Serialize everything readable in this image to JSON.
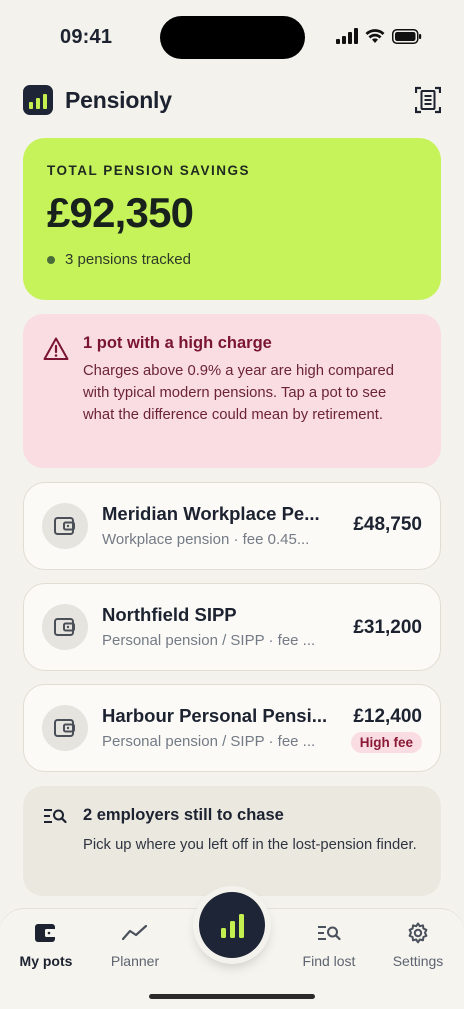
{
  "status_bar": {
    "time": "09:41"
  },
  "header": {
    "app_name": "Pensionly"
  },
  "total": {
    "label": "TOTAL PENSION SAVINGS",
    "amount": "£92,350",
    "meta": "3 pensions tracked"
  },
  "alert": {
    "title": "1 pot with a high charge",
    "text": "Charges above 0.9% a year are high compared with typical modern pensions. Tap a pot to see what the difference could mean by retirement."
  },
  "pots": [
    {
      "name": "Meridian Workplace Pe...",
      "subtitle": "Workplace pension · fee 0.45...",
      "amount": "£48,750",
      "badge": ""
    },
    {
      "name": "Northfield SIPP",
      "subtitle": "Personal pension / SIPP · fee ...",
      "amount": "£31,200",
      "badge": ""
    },
    {
      "name": "Harbour Personal Pensi...",
      "subtitle": "Personal pension / SIPP · fee ...",
      "amount": "£12,400",
      "badge": "High fee"
    }
  ],
  "chase": {
    "title": "2 employers still to chase",
    "text": "Pick up where you left off in the lost-pension finder."
  },
  "tabs": [
    {
      "label": "My pots",
      "icon": "wallet-icon",
      "active": true
    },
    {
      "label": "Planner",
      "icon": "trend-icon",
      "active": false
    },
    {
      "label": "Find lost",
      "icon": "search-list-icon",
      "active": false
    },
    {
      "label": "Settings",
      "icon": "gear-icon",
      "active": false
    }
  ],
  "colors": {
    "accent_lime": "#c7f35a",
    "navy": "#1d2536",
    "alert_bg": "#fadde3",
    "alert_text": "#7a1531",
    "background": "#f4f2ec"
  }
}
